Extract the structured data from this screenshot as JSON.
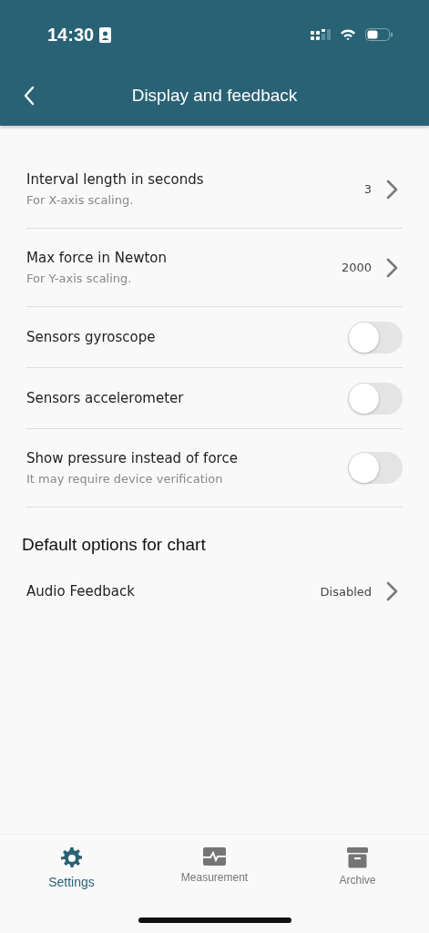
{
  "status_bar": {
    "time": "14:30"
  },
  "nav_bar": {
    "title": "Display and feedback"
  },
  "settings": [
    {
      "kind": "nav",
      "label": "Interval length in seconds",
      "description": "For X-axis scaling.",
      "value": "3"
    },
    {
      "kind": "nav",
      "label": "Max force in Newton",
      "description": "For Y-axis scaling.",
      "value": "2000"
    },
    {
      "kind": "toggle",
      "label": "Sensors gyroscope",
      "on": false
    },
    {
      "kind": "toggle",
      "label": "Sensors accelerometer",
      "on": false
    },
    {
      "kind": "toggle",
      "label": "Show pressure instead of force",
      "description": "It may require device verification",
      "on": false
    }
  ],
  "section": {
    "title": "Default options for chart",
    "items": [
      {
        "kind": "nav",
        "label": "Audio Feedback",
        "value": "Disabled"
      }
    ]
  },
  "tab_bar": [
    {
      "label": "Settings",
      "selected": true
    },
    {
      "label": "Measurement",
      "selected": false
    },
    {
      "label": "Archive",
      "selected": false
    }
  ]
}
